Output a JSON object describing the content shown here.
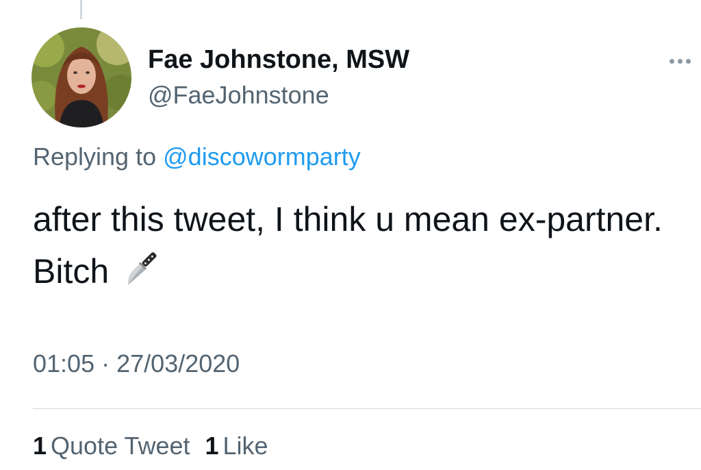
{
  "tweet": {
    "author": {
      "display_name": "Fae Johnstone, MSW",
      "handle": "@FaeJohnstone",
      "avatar_icon": "profile-photo"
    },
    "reply": {
      "prefix": "Replying to",
      "mention": "@discowormparty"
    },
    "text": "after this tweet, I think u mean ex-partner. Bitch",
    "emoji_icon": "knife-icon",
    "time": "01:05",
    "separator": "·",
    "date": "27/03/2020",
    "stats": {
      "quotes_count": "1",
      "quotes_label": "Quote Tweet",
      "likes_count": "1",
      "likes_label": "Like"
    },
    "more_icon": "more-horizontal-icon"
  },
  "colors": {
    "text_primary": "#0f1419",
    "text_secondary": "#536471",
    "link": "#1d9bf0",
    "divider": "#cfd9de"
  }
}
